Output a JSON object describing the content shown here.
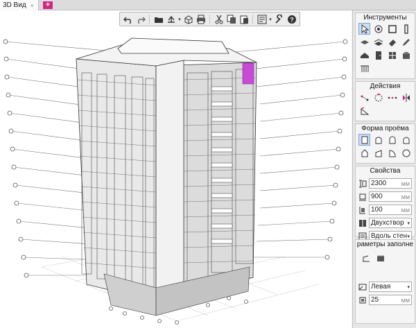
{
  "tabs": [
    {
      "label": "3D Вид",
      "close": "×"
    },
    {
      "add": "+"
    }
  ],
  "toolbar": {
    "icons": [
      "undo-icon",
      "redo-icon",
      "folder-icon",
      "save-icon",
      "export-icon",
      "print-icon",
      "cut-icon",
      "copy-icon",
      "paste-icon",
      "layers-icon",
      "settings-wrench-icon",
      "help-icon"
    ]
  },
  "panel": {
    "tools_title": "Инструменты",
    "actions_title": "Действия",
    "opening_title": "Форма проёма",
    "props_title": "Свойства",
    "height_value": "2300",
    "height_unit": "мм",
    "width_value": "900",
    "width_unit": "мм",
    "depth_value": "100",
    "depth_unit": "мм",
    "type_value": "Двухствор",
    "placement_value": "Вдоль стен",
    "fill_params_title": "раметры заполне",
    "side_value": "Левая",
    "offset_value": "25",
    "offset_unit": "мм"
  },
  "colors": {
    "accent": "#d0287e",
    "highlight": "#c74bd6",
    "panel_bg": "#e7e7e7",
    "viewport_bg": "#ffffff"
  }
}
